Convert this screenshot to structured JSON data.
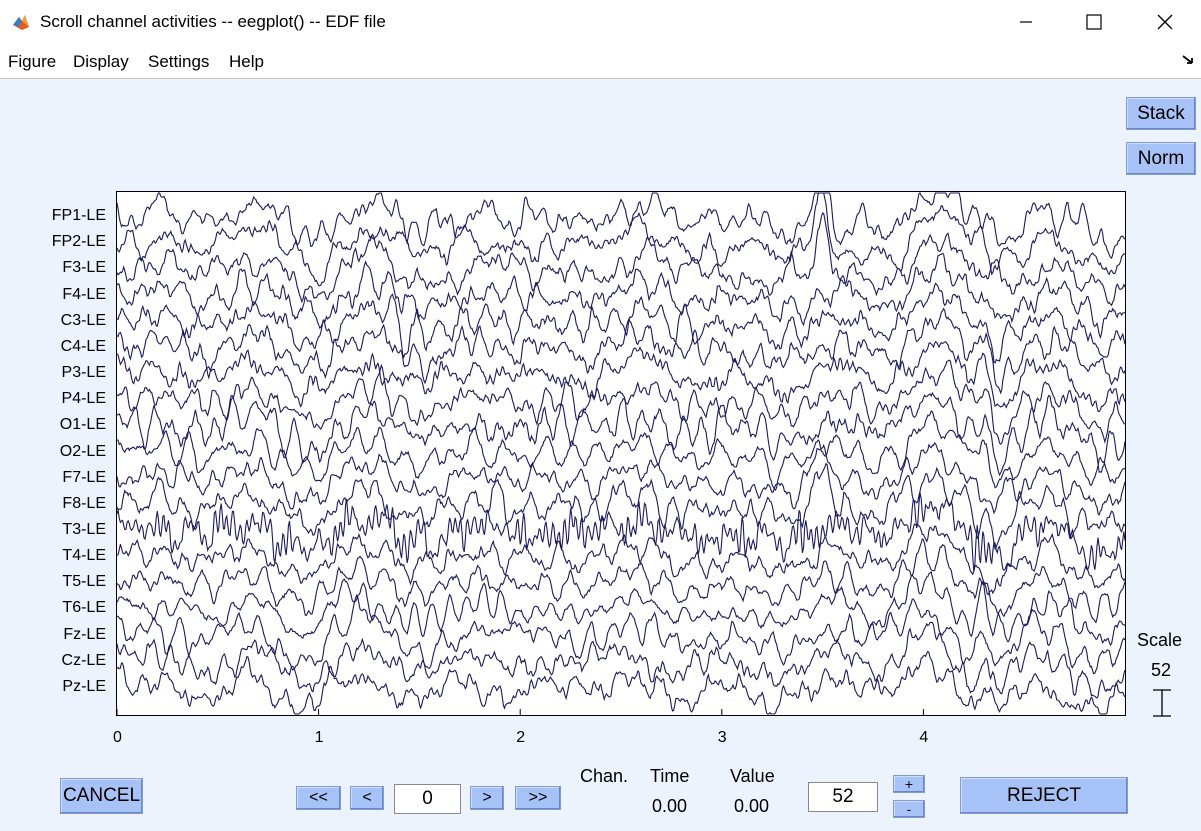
{
  "window": {
    "title": "Scroll channel activities -- eegplot() -- EDF file"
  },
  "menu": [
    "Figure",
    "Display",
    "Settings",
    "Help"
  ],
  "side_buttons": {
    "stack": "Stack",
    "norm": "Norm"
  },
  "scale": {
    "label": "Scale",
    "value": "52"
  },
  "controls": {
    "cancel": "CANCEL",
    "first": "<<",
    "prev": "<",
    "position": "0",
    "next": ">",
    "last": ">>",
    "chan_label": "Chan.",
    "time_label": "Time",
    "value_label": "Value",
    "time_value": "0.00",
    "value_value": "0.00",
    "scale_input": "52",
    "plus": "+",
    "minus": "-",
    "reject": "REJECT"
  },
  "colors": {
    "trace": "#1a1a5e",
    "button": "#a7c2f7",
    "figure_bg": "#edf3fc"
  },
  "chart_data": {
    "type": "line",
    "channels": [
      "FP1-LE",
      "FP2-LE",
      "F3-LE",
      "F4-LE",
      "C3-LE",
      "C4-LE",
      "P3-LE",
      "P4-LE",
      "O1-LE",
      "O2-LE",
      "F7-LE",
      "F8-LE",
      "T3-LE",
      "T4-LE",
      "T5-LE",
      "T6-LE",
      "Fz-LE",
      "Cz-LE",
      "Pz-LE"
    ],
    "xticks": [
      "0",
      "1",
      "2",
      "3",
      "4"
    ],
    "xlim": [
      0,
      5
    ],
    "events": [
      {
        "channels": [
          "FP1-LE",
          "FP2-LE",
          "F3-LE"
        ],
        "t": 3.5,
        "amp": 1.6
      },
      {
        "channels": [
          "F7-LE",
          "F8-LE"
        ],
        "t": 3.5,
        "amp": 1.0
      },
      {
        "channels": [
          "C4-LE",
          "P3-LE",
          "P4-LE",
          "O1-LE",
          "O2-LE",
          "T5-LE",
          "T6-LE",
          "Fz-LE",
          "Cz-LE",
          "Pz-LE"
        ],
        "t": 4.3,
        "amp": 0.9
      }
    ]
  }
}
